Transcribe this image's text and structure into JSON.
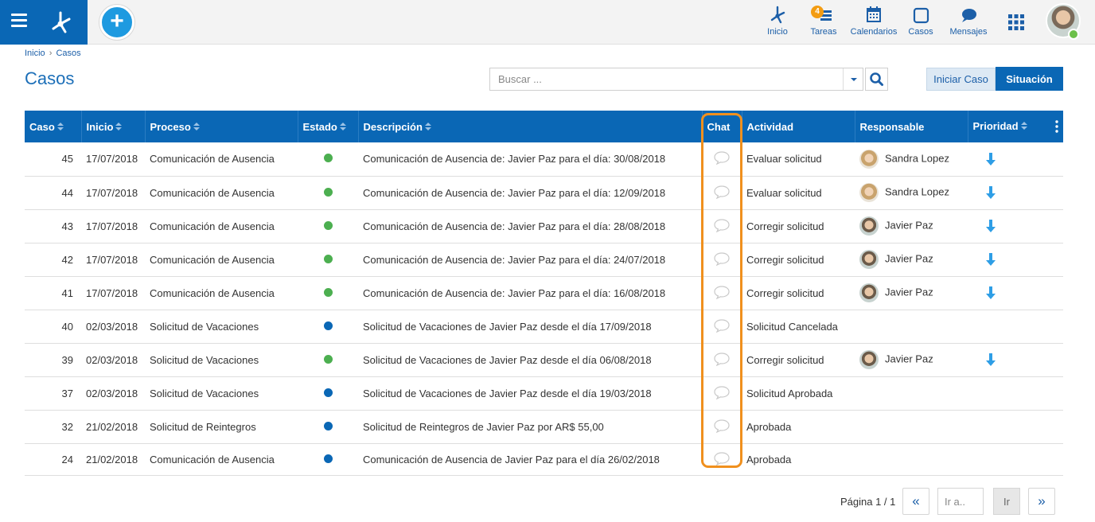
{
  "topnav": {
    "items": [
      {
        "label": "Inicio",
        "icon": "home-network-icon"
      },
      {
        "label": "Tareas",
        "icon": "tasks-icon",
        "badge": "4"
      },
      {
        "label": "Calendarios",
        "icon": "calendar-icon"
      },
      {
        "label": "Casos",
        "icon": "cases-icon"
      },
      {
        "label": "Mensajes",
        "icon": "chat-bubble-icon"
      }
    ]
  },
  "breadcrumb": {
    "home": "Inicio",
    "sep": "›",
    "current": "Casos"
  },
  "page": {
    "title": "Casos"
  },
  "search": {
    "placeholder": "Buscar ..."
  },
  "buttons": {
    "start_case": "Iniciar Caso",
    "situation": "Situación"
  },
  "table": {
    "columns": [
      "Caso",
      "Inicio",
      "Proceso",
      "Estado",
      "Descripción",
      "Chat",
      "Actividad",
      "Responsable",
      "Prioridad"
    ],
    "rows": [
      {
        "caso": "45",
        "inicio": "17/07/2018",
        "proceso": "Comunicación de Ausencia",
        "estado": "green",
        "descripcion": "Comunicación de Ausencia de: Javier Paz para el día: 30/08/2018",
        "actividad": "Evaluar solicitud",
        "responsable": "Sandra Lopez",
        "prioridad": "low"
      },
      {
        "caso": "44",
        "inicio": "17/07/2018",
        "proceso": "Comunicación de Ausencia",
        "estado": "green",
        "descripcion": "Comunicación de Ausencia de: Javier Paz para el día: 12/09/2018",
        "actividad": "Evaluar solicitud",
        "responsable": "Sandra Lopez",
        "prioridad": "low"
      },
      {
        "caso": "43",
        "inicio": "17/07/2018",
        "proceso": "Comunicación de Ausencia",
        "estado": "green",
        "descripcion": "Comunicación de Ausencia de: Javier Paz para el día: 28/08/2018",
        "actividad": "Corregir solicitud",
        "responsable": "Javier Paz",
        "prioridad": "low"
      },
      {
        "caso": "42",
        "inicio": "17/07/2018",
        "proceso": "Comunicación de Ausencia",
        "estado": "green",
        "descripcion": "Comunicación de Ausencia de: Javier Paz para el día: 24/07/2018",
        "actividad": "Corregir solicitud",
        "responsable": "Javier Paz",
        "prioridad": "low"
      },
      {
        "caso": "41",
        "inicio": "17/07/2018",
        "proceso": "Comunicación de Ausencia",
        "estado": "green",
        "descripcion": "Comunicación de Ausencia de: Javier Paz para el día: 16/08/2018",
        "actividad": "Corregir solicitud",
        "responsable": "Javier Paz",
        "prioridad": "low"
      },
      {
        "caso": "40",
        "inicio": "02/03/2018",
        "proceso": "Solicitud de Vacaciones",
        "estado": "blue",
        "descripcion": "Solicitud de Vacaciones de Javier  Paz desde el día 17/09/2018",
        "actividad": "Solicitud Cancelada",
        "responsable": "",
        "prioridad": ""
      },
      {
        "caso": "39",
        "inicio": "02/03/2018",
        "proceso": "Solicitud de Vacaciones",
        "estado": "green",
        "descripcion": "Solicitud de Vacaciones de Javier  Paz desde el día 06/08/2018",
        "actividad": "Corregir solicitud",
        "responsable": "Javier Paz",
        "prioridad": "low"
      },
      {
        "caso": "37",
        "inicio": "02/03/2018",
        "proceso": "Solicitud de Vacaciones",
        "estado": "blue",
        "descripcion": "Solicitud de Vacaciones de Javier  Paz desde el día 19/03/2018",
        "actividad": "Solicitud Aprobada",
        "responsable": "",
        "prioridad": ""
      },
      {
        "caso": "32",
        "inicio": "21/02/2018",
        "proceso": "Solicitud de Reintegros",
        "estado": "blue",
        "descripcion": "Solicitud de Reintegros de Javier  Paz por  AR$  55,00",
        "actividad": "Aprobada",
        "responsable": "",
        "prioridad": ""
      },
      {
        "caso": "24",
        "inicio": "21/02/2018",
        "proceso": "Comunicación de Ausencia",
        "estado": "blue",
        "descripcion": "Comunicación de Ausencia de Javier  Paz para el día 26/02/2018",
        "actividad": "Aprobada",
        "responsable": "",
        "prioridad": ""
      }
    ]
  },
  "pager": {
    "label": "Página 1 / 1",
    "first": "«",
    "goto_placeholder": "Ir a..",
    "go": "Ir",
    "last": "»"
  },
  "colors": {
    "brand": "#0a67b5",
    "status_green": "#4caf50",
    "status_blue": "#0a67b5",
    "highlight": "#f0901e",
    "priority_low": "#2e9ee6"
  }
}
